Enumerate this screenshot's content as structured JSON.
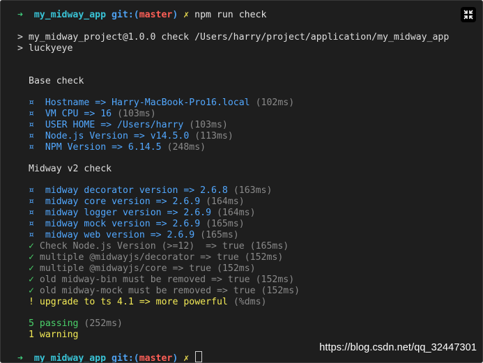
{
  "prompt": {
    "arrow": "➜",
    "directory": "my_midway_app",
    "git_prefix": "git:(",
    "branch": "master",
    "git_suffix": ")",
    "dirty_mark": "✗",
    "command": "npm run check"
  },
  "script_header": [
    "> my_midway_project@1.0.0 check /Users/harry/project/application/my_midway_app",
    "> luckyeye"
  ],
  "base_check": {
    "title": "Base check",
    "items": [
      {
        "bullet": "¤",
        "text": "Hostname => Harry-MacBook-Pro16.local",
        "time": "(102ms)"
      },
      {
        "bullet": "¤",
        "text": "VM CPU => 16",
        "time": "(103ms)"
      },
      {
        "bullet": "¤",
        "text": "USER HOME => /Users/harry",
        "time": "(103ms)"
      },
      {
        "bullet": "¤",
        "text": "Node.js Version => v14.5.0",
        "time": "(113ms)"
      },
      {
        "bullet": "¤",
        "text": "NPM Version => 6.14.5",
        "time": "(248ms)"
      }
    ]
  },
  "midway_check": {
    "title": "Midway v2 check",
    "info_items": [
      {
        "bullet": "¤",
        "text": "midway decorator version => 2.6.8",
        "time": "(163ms)"
      },
      {
        "bullet": "¤",
        "text": "midway core version => 2.6.9",
        "time": "(164ms)"
      },
      {
        "bullet": "¤",
        "text": "midway logger version => 2.6.9",
        "time": "(164ms)"
      },
      {
        "bullet": "¤",
        "text": "midway mock version => 2.6.9",
        "time": "(165ms)"
      },
      {
        "bullet": "¤",
        "text": "midway web version => 2.6.9",
        "time": "(165ms)"
      }
    ],
    "pass_items": [
      {
        "bullet": "✓",
        "text": "Check Node.js Version (>=12)  => true",
        "time": "(165ms)"
      },
      {
        "bullet": "✓",
        "text": "multiple @midwayjs/decorator => true",
        "time": "(152ms)"
      },
      {
        "bullet": "✓",
        "text": "multiple @midwayjs/core => true",
        "time": "(152ms)"
      },
      {
        "bullet": "✓",
        "text": "old midway-bin must be removed => true",
        "time": "(152ms)"
      },
      {
        "bullet": "✓",
        "text": "old midway-mock must be removed => true",
        "time": "(152ms)"
      }
    ],
    "warn_item": {
      "bullet": "!",
      "text": "upgrade to ts 4.1 => more powerful",
      "time": "(%dms)"
    }
  },
  "summary": {
    "passing": "5 passing",
    "passing_time": "(252ms)",
    "warning": "1 warning"
  },
  "watermark": "https://blog.csdn.net/qq_32447301",
  "colors": {
    "background": "#1e1e1e",
    "arrow": "#3fc77a",
    "directory": "#39c3d6",
    "git": "#4ea0ef",
    "branch": "#ff5f57",
    "info": "#52a8ff",
    "pass": "#4ad26a",
    "warn": "#f3ea56",
    "muted": "#8a8a8a"
  },
  "icons": {
    "fullscreen": "fullscreen-exit-icon"
  }
}
